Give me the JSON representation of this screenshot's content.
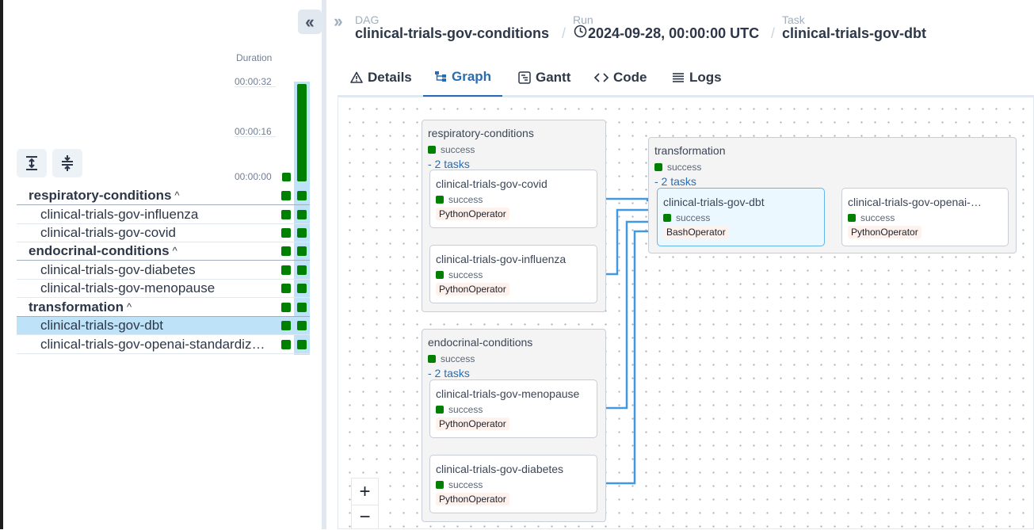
{
  "left_panel": {
    "collapse_icon": "double-chevron-left-icon",
    "duration_label": "Duration",
    "duration_ticks": [
      "00:00:32",
      "00:00:16",
      "00:00:00"
    ],
    "run_bars": [
      {
        "label": "previous run",
        "duration_fraction": 0.09
      },
      {
        "label": "selected run",
        "duration_fraction": 0.98
      }
    ],
    "tools": [
      {
        "name": "expand-all-icon"
      },
      {
        "name": "collapse-all-icon"
      }
    ],
    "rows": [
      {
        "label": "respiratory-conditions",
        "type": "group",
        "chevron": "^"
      },
      {
        "label": "clinical-trials-gov-influenza",
        "type": "task"
      },
      {
        "label": "clinical-trials-gov-covid",
        "type": "task"
      },
      {
        "label": "endocrinal-conditions",
        "type": "group",
        "chevron": "^"
      },
      {
        "label": "clinical-trials-gov-diabetes",
        "type": "task"
      },
      {
        "label": "clinical-trials-gov-menopause",
        "type": "task"
      },
      {
        "label": "transformation",
        "type": "group",
        "chevron": "^"
      },
      {
        "label": "clinical-trials-gov-dbt",
        "type": "task",
        "selected": true
      },
      {
        "label": "clinical-trials-gov-openai-standardiz…",
        "type": "task"
      }
    ]
  },
  "header": {
    "expand_icon": "double-chevron-right-icon",
    "dag_label": "DAG",
    "dag_value": "clinical-trials-gov-conditions",
    "run_label": "Run",
    "run_value": "2024-09-28, 00:00:00 UTC",
    "task_label": "Task",
    "task_value": "clinical-trials-gov-dbt",
    "separator": "/"
  },
  "tabs": [
    {
      "label": "Details",
      "icon": "warning-triangle-icon",
      "active": false
    },
    {
      "label": "Graph",
      "icon": "graph-icon",
      "active": true
    },
    {
      "label": "Gantt",
      "icon": "gantt-icon",
      "active": false
    },
    {
      "label": "Code",
      "icon": "code-icon",
      "active": false
    },
    {
      "label": "Logs",
      "icon": "logs-icon",
      "active": false
    }
  ],
  "graph": {
    "groups": [
      {
        "title": "respiratory-conditions",
        "status": "success",
        "toggle": "- 2 tasks"
      },
      {
        "title": "endocrinal-conditions",
        "status": "success",
        "toggle": "- 2 tasks"
      },
      {
        "title": "transformation",
        "status": "success",
        "toggle": "- 2 tasks"
      }
    ],
    "tasks": [
      {
        "title": "clinical-trials-gov-covid",
        "status": "success",
        "operator": "PythonOperator"
      },
      {
        "title": "clinical-trials-gov-influenza",
        "status": "success",
        "operator": "PythonOperator"
      },
      {
        "title": "clinical-trials-gov-menopause",
        "status": "success",
        "operator": "PythonOperator"
      },
      {
        "title": "clinical-trials-gov-diabetes",
        "status": "success",
        "operator": "PythonOperator"
      },
      {
        "title": "clinical-trials-gov-dbt",
        "status": "success",
        "operator": "BashOperator"
      },
      {
        "title": "clinical-trials-gov-openai-…",
        "status": "success",
        "operator": "PythonOperator"
      }
    ],
    "zoom_in": "+",
    "zoom_out": "−"
  },
  "colors": {
    "success": "#008000",
    "accent": "#2b6cb0",
    "edge": "#4299e1",
    "selected_row": "#bee3f8"
  }
}
